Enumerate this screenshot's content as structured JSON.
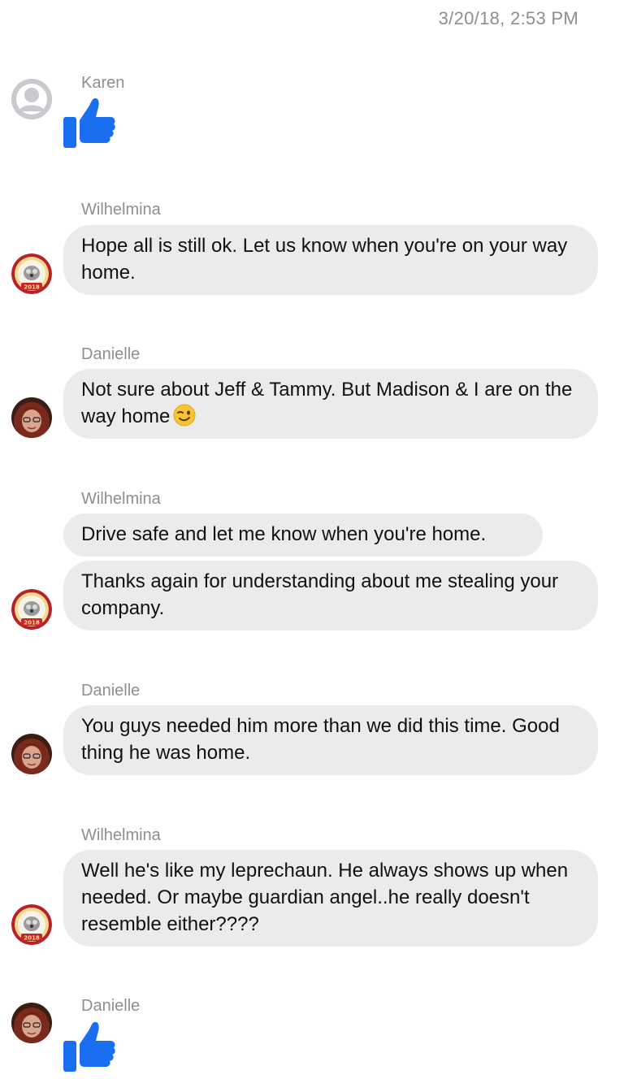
{
  "header": {
    "timestamp": "3/20/18, 2:53 PM"
  },
  "messages": [
    {
      "sender": "Karen",
      "type": "like",
      "icon": "thumbs-up-icon"
    },
    {
      "sender": "Wilhelmina",
      "type": "text",
      "text": "Hope all is still ok. Let us know when you're on your way home."
    },
    {
      "sender": "Danielle",
      "type": "text",
      "text": "Not sure about Jeff & Tammy. But Madison & I are on the way home",
      "emoji": "winking-face-emoji"
    },
    {
      "sender": "Wilhelmina",
      "type": "text",
      "texts": [
        "Drive safe and let me know when you're home.",
        "Thanks again for understanding about me stealing your company."
      ]
    },
    {
      "sender": "Danielle",
      "type": "text",
      "text": "You guys needed him more than we did this time. Good thing he was home."
    },
    {
      "sender": "Wilhelmina",
      "type": "text",
      "text": "Well he's like my leprechaun. He always shows up when needed. Or maybe guardian angel..he really doesn't resemble either????"
    },
    {
      "sender": "Danielle",
      "type": "like",
      "icon": "thumbs-up-icon"
    }
  ],
  "avatars": {
    "wilhelmina_badge_year": "2018"
  },
  "colors": {
    "bubble_bg": "#ebebeb",
    "like_blue": "#1a6ff0",
    "meta_gray": "#8e8e93"
  }
}
